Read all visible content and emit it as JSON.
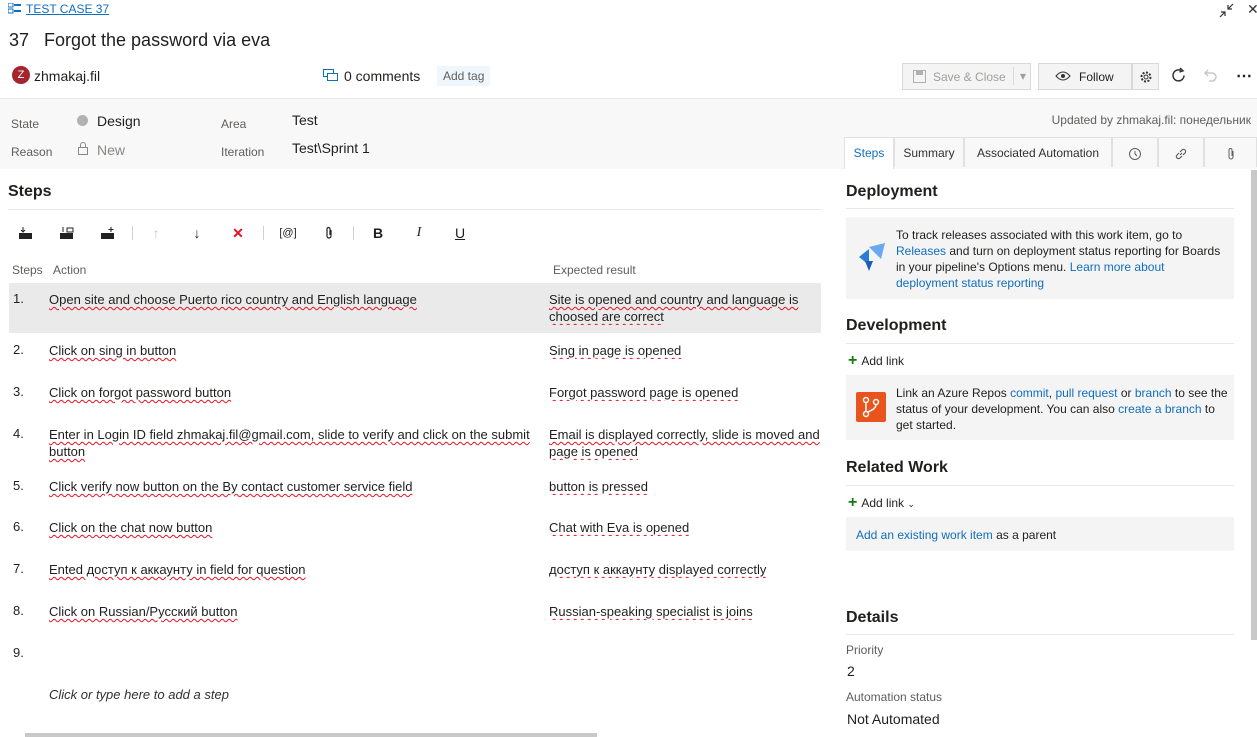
{
  "header": {
    "type_link": "TEST CASE 37",
    "id": "37",
    "title": "Forgot the password via eva",
    "avatar_letter": "Z",
    "owner": "zhmakaj.fil",
    "comments": "0 comments",
    "add_tag": "Add tag",
    "save_close": "Save & Close",
    "follow": "Follow",
    "updated": "Updated by zhmakaj.fil: понедельник"
  },
  "fields": {
    "state_label": "State",
    "state_value": "Design",
    "reason_label": "Reason",
    "reason_value": "New",
    "area_label": "Area",
    "area_value": "Test",
    "iteration_label": "Iteration",
    "iteration_value": "Test\\Sprint 1"
  },
  "tabs": {
    "steps": "Steps",
    "summary": "Summary",
    "automation": "Associated Automation"
  },
  "steps": {
    "title": "Steps",
    "col_steps": "Steps",
    "col_action": "Action",
    "col_expected": "Expected result",
    "rows": [
      {
        "n": "1.",
        "action": "Open site and choose Puerto rico country and English language",
        "expected": "Site is opened and country and language is choosed are correct"
      },
      {
        "n": "2.",
        "action": "Click on sing in button",
        "expected": "Sing in page is opened"
      },
      {
        "n": "3.",
        "action": "Click on forgot password button",
        "expected": "Forgot password page is opened"
      },
      {
        "n": "4.",
        "action": "Enter in Login ID field zhmakaj.fil@gmail.com, slide to verify and click on the submit button",
        "expected": "Email is displayed correctly, slide is moved and page is opened"
      },
      {
        "n": "5.",
        "action": "Click verify now button on the By contact customer service field",
        "expected": "button is pressed"
      },
      {
        "n": "6.",
        "action": "Click on the chat now button",
        "expected": "Chat with Eva is opened"
      },
      {
        "n": "7.",
        "action": "Ented доступ к аккаунту in field for question",
        "expected": "доступ к аккаунту displayed correctly"
      },
      {
        "n": "8.",
        "action": "Click on Russian/Русский button",
        "expected": "Russian-speaking specialist is joins"
      },
      {
        "n": "9.",
        "action": "",
        "expected": ""
      }
    ],
    "add_step": "Click or type here to add a step"
  },
  "deployment": {
    "title": "Deployment",
    "text1": "To track releases associated with this work item, go to",
    "releases": "Releases",
    "text2": "and turn on deployment status reporting for Boards in your pipeline's Options menu.",
    "learn_more": "Learn more about deployment status reporting"
  },
  "development": {
    "title": "Development",
    "add_link": "Add link",
    "t1": "Link an Azure Repos",
    "commit": "commit",
    "pull_request": "pull request",
    "t_or": "or",
    "branch": "branch",
    "t2": "to see the status of your development. You can also",
    "create_branch": "create a branch",
    "t3": "to get started."
  },
  "related": {
    "title": "Related Work",
    "add_link": "Add link",
    "existing": "Add an existing work item",
    "as_parent": "as a parent"
  },
  "details": {
    "title": "Details",
    "priority_label": "Priority",
    "priority_value": "2",
    "automation_label": "Automation status",
    "automation_value": "Not Automated"
  },
  "colors": {
    "accent": "#106ebe",
    "avatar": "#a4262c",
    "add_green": "#107c10",
    "dev_icon": "#e8541c",
    "deploy_icon": "#2b7cd3"
  }
}
